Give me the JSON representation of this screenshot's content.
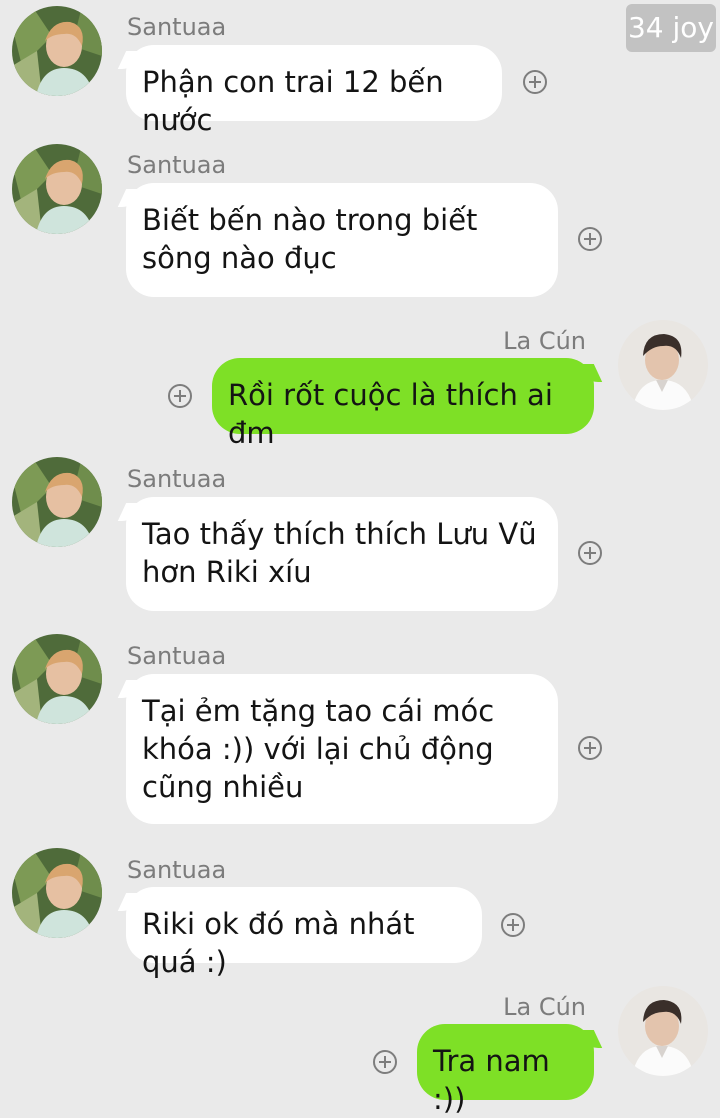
{
  "watermark": "34 joy",
  "messages": [
    {
      "sender": "Santuaa",
      "direction": "incoming",
      "text": "Phận con trai 12 bến nước",
      "avatar_icon": "avatar-santuaa-icon"
    },
    {
      "sender": "Santuaa",
      "direction": "incoming",
      "text": "Biết bến nào trong biết sông nào đục",
      "avatar_icon": "avatar-santuaa-icon"
    },
    {
      "sender": "La Cún",
      "direction": "outgoing",
      "text": "Rồi rốt cuộc là thích ai đm",
      "avatar_icon": "avatar-la-cun-icon"
    },
    {
      "sender": "Santuaa",
      "direction": "incoming",
      "text": "Tao thấy thích thích Lưu Vũ hơn Riki xíu",
      "avatar_icon": "avatar-santuaa-icon"
    },
    {
      "sender": "Santuaa",
      "direction": "incoming",
      "text": "Tại ẻm tặng tao cái móc khóa :)) với lại chủ động cũng nhiều",
      "avatar_icon": "avatar-santuaa-icon"
    },
    {
      "sender": "Santuaa",
      "direction": "incoming",
      "text": "Riki ok đó mà nhát quá :)",
      "avatar_icon": "avatar-santuaa-icon"
    },
    {
      "sender": "La Cún",
      "direction": "outgoing",
      "text": "Tra nam :))",
      "avatar_icon": "avatar-la-cun-icon"
    }
  ],
  "colors": {
    "background": "#eaeaea",
    "incoming_bubble": "#ffffff",
    "outgoing_bubble": "#7ee026",
    "sender_name": "#7c7c7c"
  },
  "icons": {
    "add_reaction": "plus-circle-icon"
  }
}
